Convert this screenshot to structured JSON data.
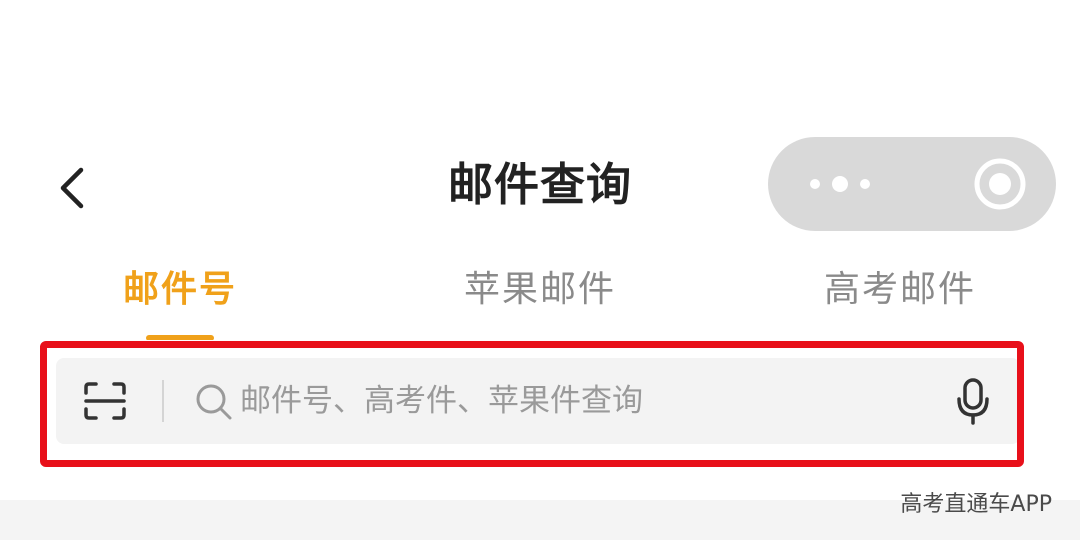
{
  "header": {
    "title": "邮件查询",
    "back_icon": "chevron-left-icon",
    "capsule": {
      "more_icon": "more-dots-icon",
      "close_icon": "target-close-icon"
    }
  },
  "tabs": [
    {
      "label": "邮件号",
      "active": true
    },
    {
      "label": "苹果邮件",
      "active": false
    },
    {
      "label": "高考邮件",
      "active": false
    }
  ],
  "search": {
    "value": "",
    "placeholder": "邮件号、高考件、苹果件查询",
    "scan_icon": "scan-icon",
    "search_icon": "search-icon",
    "mic_icon": "microphone-icon"
  },
  "colors": {
    "accent": "#f0a11a",
    "highlight": "#e8101a",
    "capsule": "#d9d9d9"
  },
  "watermark": "高考直通车APP"
}
